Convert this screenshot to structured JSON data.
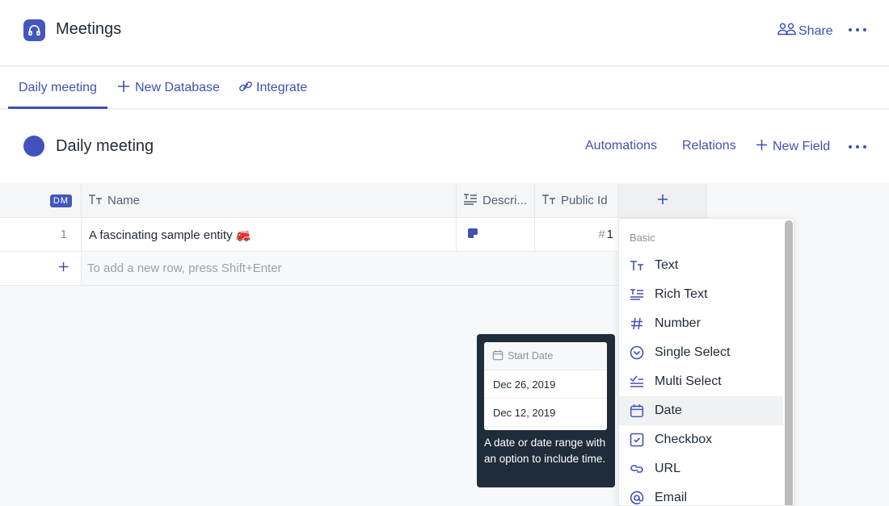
{
  "app": {
    "title": "Meetings",
    "logo_icon": "headphones-icon",
    "share_label": "Share",
    "share_icon": "users-icon",
    "more_icon": "more-horizontal-icon"
  },
  "tabs": [
    {
      "label": "Daily meeting",
      "active": true
    },
    {
      "label": "New Database",
      "icon": "plus-icon"
    },
    {
      "label": "Integrate",
      "icon": "link-icon"
    }
  ],
  "database": {
    "title": "Daily meeting",
    "color": "#4252bd",
    "actions": {
      "automations": "Automations",
      "relations": "Relations",
      "new_field": "New Field"
    }
  },
  "table": {
    "badge": "DM",
    "columns": [
      {
        "label": "Name",
        "icon": "text-type-icon"
      },
      {
        "label": "Descri...",
        "icon": "rich-text-icon"
      },
      {
        "label": "Public Id",
        "icon": "text-type-icon"
      }
    ],
    "add_column_label": "+",
    "rows": [
      {
        "index": "1",
        "name": "A fascinating sample entity 🚒",
        "description_icon": "note-icon",
        "public_id_prefix": "#",
        "public_id": "1"
      }
    ],
    "add_row_label": "+",
    "add_row_hint": "To add a new row, press Shift+Enter"
  },
  "field_menu": {
    "section": "Basic",
    "items": [
      {
        "label": "Text",
        "icon": "text-type-icon"
      },
      {
        "label": "Rich Text",
        "icon": "rich-text-icon"
      },
      {
        "label": "Number",
        "icon": "hash-icon"
      },
      {
        "label": "Single Select",
        "icon": "chevron-circle-icon"
      },
      {
        "label": "Multi Select",
        "icon": "multi-check-icon"
      },
      {
        "label": "Date",
        "icon": "calendar-icon",
        "hovered": true
      },
      {
        "label": "Checkbox",
        "icon": "checkbox-icon"
      },
      {
        "label": "URL",
        "icon": "url-link-icon"
      },
      {
        "label": "Email",
        "icon": "at-icon"
      }
    ]
  },
  "tooltip": {
    "preview_header": "Start Date",
    "preview_rows": [
      "Dec 26, 2019",
      "Dec 12, 2019"
    ],
    "description": "A date or date range with an option to include time."
  }
}
